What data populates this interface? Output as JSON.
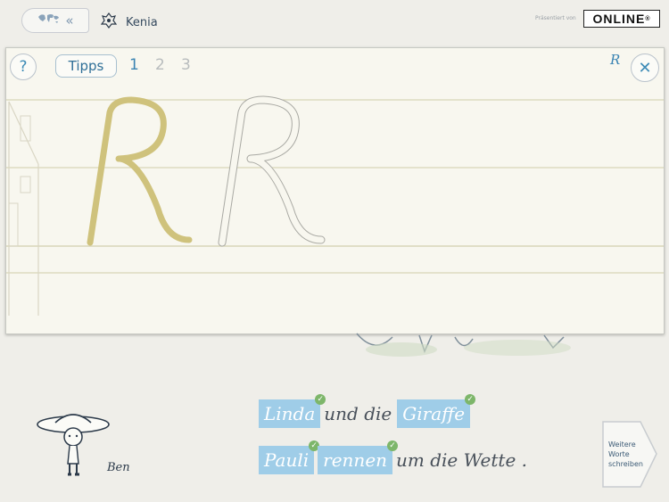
{
  "header": {
    "country_name": "Kenia",
    "sponsor_text": "Präsentiert von",
    "logo_text": "ONLINE",
    "logo_mark": "®",
    "back_chevrons": "«"
  },
  "toolbar": {
    "help_label": "?",
    "tips_label": "Tipps",
    "steps": [
      "1",
      "2",
      "3"
    ],
    "active_step": 1,
    "letter_hint": "R",
    "close_label": "✕"
  },
  "practice": {
    "traced_letter": "R",
    "outline_letter": "R",
    "traced_color": "#cfc27c",
    "outline_color": "#a9a9a3"
  },
  "sentences": [
    {
      "parts": [
        {
          "text": "Linda",
          "highlighted": true,
          "checked": true
        },
        {
          "text": "und die",
          "highlighted": false,
          "checked": false
        },
        {
          "text": "Giraffe",
          "highlighted": true,
          "checked": true
        }
      ]
    },
    {
      "parts": [
        {
          "text": "Pauli",
          "highlighted": true,
          "checked": true
        },
        {
          "text": "rennen",
          "highlighted": true,
          "checked": true
        },
        {
          "text": "um die Wette .",
          "highlighted": false,
          "checked": false
        }
      ]
    }
  ],
  "more_words_button": {
    "label_line1": "Weitere",
    "label_line2": "Worte",
    "label_line3": "schreiben"
  },
  "character": {
    "name": "Ben"
  },
  "colors": {
    "accent": "#3a84b3",
    "highlight": "#9fcde8",
    "check": "#7db66a"
  }
}
